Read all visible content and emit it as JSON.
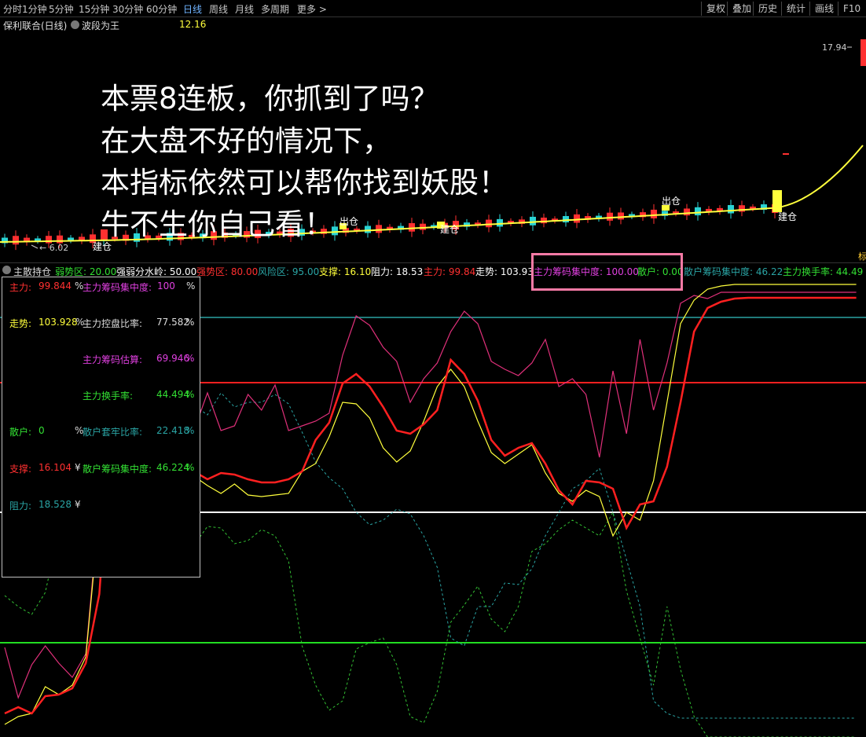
{
  "toolbar": {
    "periods": [
      "分时",
      "1分钟",
      "5分钟",
      "15分钟",
      "30分钟",
      "60分钟",
      "日线",
      "周线",
      "月线",
      "多周期",
      "更多 >"
    ],
    "active_period": "日线",
    "right_buttons": [
      "复权",
      "叠加",
      "历史",
      "统计",
      "画线",
      "F10"
    ]
  },
  "infobar": {
    "stock_title": "保利联合(日线)",
    "indicator_name": "波段为王",
    "indicator_value": "12.16"
  },
  "main_chart": {
    "price_high_label": "17.94",
    "price_low_label": "6.02",
    "signals": [
      {
        "label": "建仓",
        "color": "#ffffff"
      },
      {
        "label": "出仓",
        "color": "#ffffff"
      },
      {
        "label": "建仓",
        "color": "#ffffff"
      },
      {
        "label": "出仓",
        "color": "#ffffff"
      },
      {
        "label": "建仓",
        "color": "#ffffff"
      }
    ],
    "right_edge_label": "标"
  },
  "overlay_text": {
    "line1": "本票8连板，你抓到了吗？",
    "line2": "在大盘不好的情况下，",
    "line3": "本指标依然可以帮你找到妖股！",
    "line4": "牛不生你自己看！"
  },
  "indicator_header": {
    "name": "主散持仓",
    "items": [
      {
        "label": "弱势区: 20.00",
        "color": "#33e033"
      },
      {
        "label": "强弱分水岭: 50.00",
        "color": "#ffffff"
      },
      {
        "label": "强势区: 80.00",
        "color": "#ff3030"
      },
      {
        "label": "风险区: 95.00",
        "color": "#2aa4a4"
      },
      {
        "label": "支撑: 16.10",
        "color": "#ffff3c"
      },
      {
        "label": "阻力: 18.53",
        "color": "#ffffff"
      },
      {
        "label": "主力: 99.84",
        "color": "#ff3030"
      },
      {
        "label": "走势: 103.93",
        "color": "#ffffff"
      },
      {
        "label": "主力筹码集中度: 100.00",
        "color": "#e040e0"
      },
      {
        "label": "散户: 0.00",
        "color": "#33e033"
      },
      {
        "label": "散户筹码集中度: 46.22",
        "color": "#2aa4a4"
      },
      {
        "label": "主力换手率: 44.49",
        "color": "#33e033"
      }
    ]
  },
  "stats_panel": {
    "zhuli_label": "主力:",
    "zhuli_value": "99.844",
    "zhuli_unit": "%",
    "conc_label": "主力筹码集中度:",
    "conc_value": "100",
    "conc_unit": "%",
    "zoushi_label": "走势:",
    "zoushi_value": "103.928",
    "zoushi_unit": "%",
    "kongpan_label": "主力控盘比率:",
    "kongpan_value": "77.582",
    "kongpan_unit": "%",
    "guji_label": "主力筹码估算:",
    "guji_value": "69.946",
    "guji_unit": "%",
    "huanshou_label": "主力换手率:",
    "huanshou_value": "44.494",
    "huanshou_unit": "%",
    "sanhu_label": "散户:",
    "sanhu_value": "0",
    "sanhu_unit": "%",
    "taolao_label": "散户套牢比率:",
    "taolao_value": "22.418",
    "taolao_unit": "%",
    "zhicheng_label": "支撑:",
    "zhicheng_value": "16.104",
    "zhicheng_unit": "¥",
    "sanhu_conc_label": "散户筹码集中度:",
    "sanhu_conc_value": "46.224",
    "sanhu_conc_unit": "%",
    "zuli_label": "阻力:",
    "zuli_value": "18.528",
    "zuli_unit": "¥"
  },
  "colors": {
    "up": "#ff3030",
    "down": "#2ad4d4",
    "ma": "#ffff3c",
    "highlight": "#f77aa5"
  }
}
